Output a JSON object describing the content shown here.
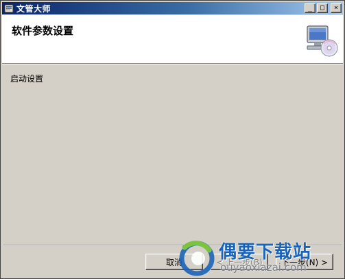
{
  "window": {
    "title": "文管大师",
    "minimize_glyph": "_",
    "maximize_glyph": "□",
    "close_glyph": "×"
  },
  "header": {
    "title": "软件参数设置",
    "graphic_icon": "computer-cd-icon"
  },
  "body": {
    "startup_label": "启动设置"
  },
  "buttons": {
    "cancel_label": "取消",
    "back_label": "< 上一步(B)",
    "next_label": "下一步(N) >"
  },
  "watermark": {
    "title": "偶要下载站",
    "url": "ouyaoxiazai.com"
  },
  "colors": {
    "titlebar_start": "#0a246a",
    "titlebar_end": "#a6caf0",
    "dialog_face": "#d4d0c8",
    "watermark_blue": "#1a63b8"
  }
}
